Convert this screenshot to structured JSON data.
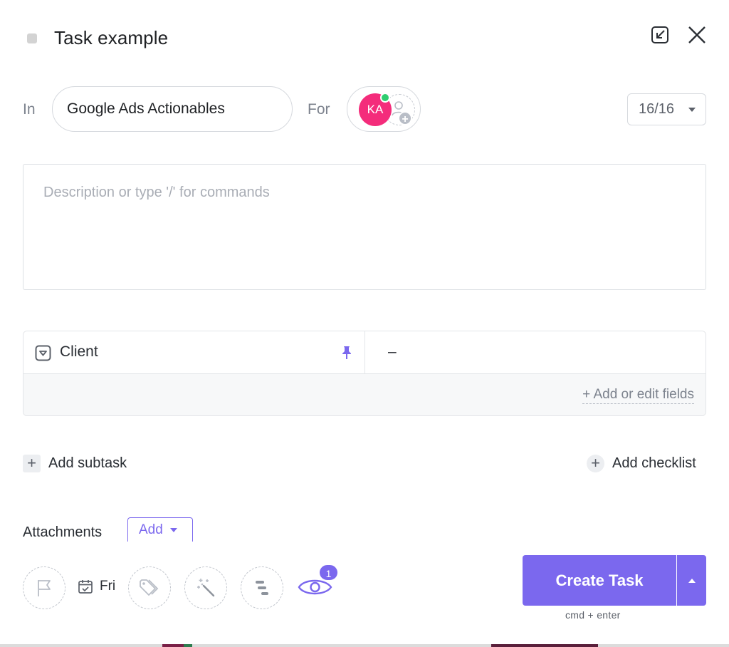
{
  "header": {
    "title": "Task example",
    "minimize_icon": "minimize-arrow-icon",
    "close_icon": "close-icon"
  },
  "location": {
    "in_label": "In",
    "list_name": "Google Ads Actionables",
    "for_label": "For"
  },
  "assignee": {
    "initials": "KA",
    "avatar_color": "#f42c7b",
    "online_color": "#2ecd6f",
    "add_badge": "+"
  },
  "status_count": {
    "value": "16/16"
  },
  "description": {
    "placeholder": "Description or type '/' for commands"
  },
  "custom_fields": {
    "rows": [
      {
        "name": "Client",
        "value": "–"
      }
    ],
    "add_edit_label": "+ Add or edit fields"
  },
  "actions": {
    "subtask_plus": "+",
    "subtask_label": "Add subtask",
    "checklist_plus": "+",
    "checklist_label": "Add checklist"
  },
  "attachments": {
    "label": "Attachments",
    "add_label": "Add"
  },
  "toolbar": {
    "due_label": "Fri",
    "watcher_count": "1"
  },
  "submit": {
    "label": "Create Task",
    "shortcut": "cmd + enter"
  },
  "colors": {
    "accent": "#7b68ee",
    "text": "#292d34",
    "muted": "#7c828d"
  }
}
